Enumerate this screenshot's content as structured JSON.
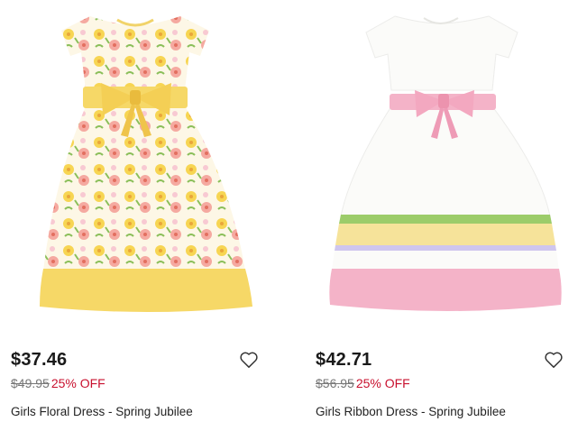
{
  "products": [
    {
      "name": "Girls Floral Dress - Spring Jubilee",
      "price": "$37.46",
      "original_price": "$49.95",
      "discount": "25% OFF",
      "wishlist_icon": "heart-outline-icon"
    },
    {
      "name": "Girls Ribbon Dress - Spring Jubilee",
      "price": "$42.71",
      "original_price": "$56.95",
      "discount": "25% OFF",
      "wishlist_icon": "heart-outline-icon"
    }
  ],
  "colors": {
    "discount": "#c8102e",
    "strike_price": "#777777",
    "floral_yellow": "#f6d867",
    "ribbon_pink": "#f4b3c8"
  }
}
